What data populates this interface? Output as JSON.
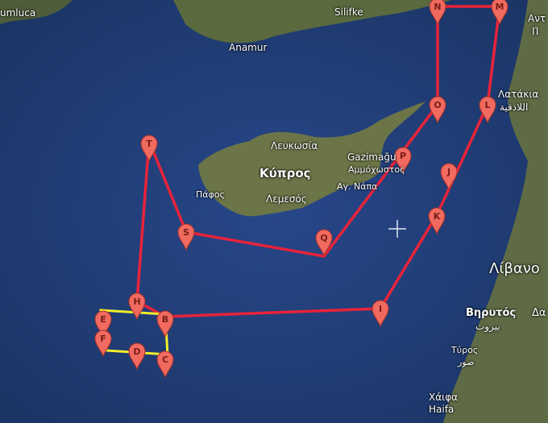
{
  "map": {
    "colors": {
      "sea": "#1e3c6e",
      "land": "#5e6b45",
      "route": "#e8233a",
      "box": "#f2ee2c",
      "marker": "#f06a5f",
      "marker_outline": "#a8322a"
    },
    "labels": {
      "turkey_left": "umluca",
      "silifke": "Silifke",
      "anamur": "Anamur",
      "syria_top": "Αντ",
      "syria_top2": "ΙΊ",
      "latakia_gr": "Λατάκια",
      "latakia_ar": "اللاذقية",
      "lefkosia": "Λευκωσία",
      "kypros": "Κύπρος",
      "gazimagusa": "Gazimağu",
      "ammochostos": "Αμμόχωστος",
      "pafos": "Πάφος",
      "lemesos": "Λεμεσός",
      "agia_napa": "Αγ. Νάπα",
      "lebanon": "Λίβανο",
      "beirut_gr": "Βηρυτός",
      "damascus": "Δα",
      "beirut_ar": "بيروت",
      "tyros": "Τύρος",
      "sour": "صور",
      "haifa_gr": "Χάιφα",
      "haifa_en": "Haifa"
    },
    "markers": [
      {
        "letter": "N"
      },
      {
        "letter": "M"
      },
      {
        "letter": "O"
      },
      {
        "letter": "L"
      },
      {
        "letter": "T"
      },
      {
        "letter": "P"
      },
      {
        "letter": "J"
      },
      {
        "letter": "K"
      },
      {
        "letter": "S"
      },
      {
        "letter": "Q"
      },
      {
        "letter": "H"
      },
      {
        "letter": "I"
      },
      {
        "letter": "B"
      },
      {
        "letter": "E"
      },
      {
        "letter": "F"
      },
      {
        "letter": "D"
      },
      {
        "letter": "C"
      }
    ]
  }
}
